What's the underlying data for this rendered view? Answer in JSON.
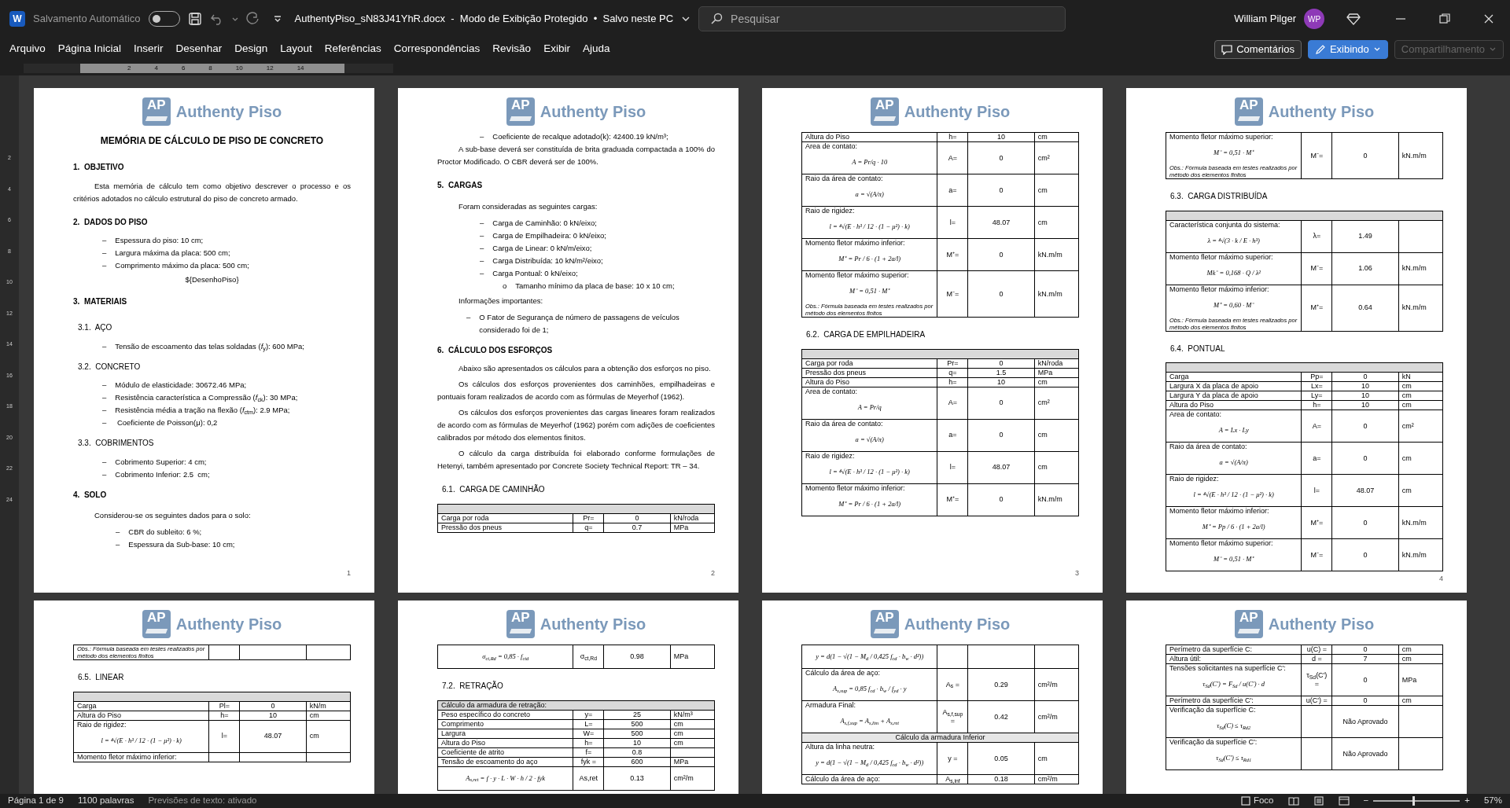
{
  "title_bar": {
    "app_letter": "W",
    "autosave_label": "Salvamento Automático",
    "autosave_on": false,
    "document_title": "AuthentyPiso_sN83J41YhR.docx  -  Modo de Exibição Protegido  •  Salvo neste PC",
    "search_placeholder": "Pesquisar",
    "user_name": "William Pilger",
    "avatar": "WP"
  },
  "ribbon_tabs": [
    {
      "label": "Arquivo",
      "selected": false
    },
    {
      "label": "Página Inicial",
      "selected": false
    },
    {
      "label": "Inserir",
      "selected": false
    },
    {
      "label": "Desenhar",
      "selected": false
    },
    {
      "label": "Design",
      "selected": false
    },
    {
      "label": "Layout",
      "selected": false
    },
    {
      "label": "Referências",
      "selected": false
    },
    {
      "label": "Correspondências",
      "selected": false
    },
    {
      "label": "Revisão",
      "selected": false
    },
    {
      "label": "Exibir",
      "selected": false
    },
    {
      "label": "Ajuda",
      "selected": false
    }
  ],
  "ribbon_buttons": [
    {
      "kind": "comments",
      "label": "Comentários",
      "disabled": false
    },
    {
      "kind": "mode",
      "label": "Exibindo",
      "disabled": false
    },
    {
      "kind": "share",
      "label": "Compartilhamento",
      "disabled": true
    }
  ],
  "ruler": {
    "numbers": [
      "2",
      "4",
      "6",
      "8",
      "10",
      "12",
      "14"
    ],
    "vertical_numbers": [
      "2",
      "4",
      "6",
      "8",
      "10",
      "12",
      "14",
      "16",
      "18",
      "20",
      "22",
      "24"
    ]
  },
  "pages": [
    {
      "logo_mark": "AP",
      "logo_name": "Authenty Piso",
      "blocks": [
        {
          "kind": "title",
          "text": "MEMÓRIA DE CÁLCULO DE PISO DE CONCRETO"
        },
        {
          "kind": "h1",
          "text": "1.  OBJETIVO"
        },
        {
          "kind": "para",
          "text": "Esta memória de cálculo tem como objetivo descrever o processo e os critérios adotados no cálculo estrutural do piso de concreto armado."
        },
        {
          "kind": "h1",
          "text": "2.  DADOS DO PISO"
        },
        {
          "kind": "item",
          "marker": "–",
          "text": "Espessura do piso: 10 cm;"
        },
        {
          "kind": "item",
          "marker": "–",
          "text": "Largura máxima da placa: 500 cm;"
        },
        {
          "kind": "item",
          "marker": "–",
          "text": "Comprimento máximo da placa: 500 cm;"
        },
        {
          "kind": "center",
          "text": "${DesenhoPiso}"
        },
        {
          "kind": "h1",
          "text": "3.  MATERIAIS"
        },
        {
          "kind": "h2",
          "text": "3.1.  AÇO"
        },
        {
          "kind": "item",
          "marker": "–",
          "text": "Tensão de escoamento das telas soldadas (*f*$_{y}$): 600 MPa;"
        },
        {
          "kind": "h2",
          "text": "3.2.  CONCRETO"
        },
        {
          "kind": "item",
          "marker": "–",
          "text": "Módulo de elasticidade: 30672.46 MPa;"
        },
        {
          "kind": "item",
          "marker": "–",
          "text": "Resistência característica a Compressão (*f*$_{ck}$): 30 MPa;"
        },
        {
          "kind": "item",
          "marker": "–",
          "text": "Resistência média a tração na flexão (*f*$_{ctm}$): 2.9 MPa;"
        },
        {
          "kind": "item",
          "marker": "–",
          "text": " Coeficiente de Poisson(μ): 0,2"
        },
        {
          "kind": "h2",
          "text": "3.3.  COBRIMENTOS"
        },
        {
          "kind": "item",
          "marker": "–",
          "text": "Cobrimento Superior: 4 cm;"
        },
        {
          "kind": "item",
          "marker": "–",
          "text": "Cobrimento Inferior: 2.5  cm;"
        },
        {
          "kind": "h1",
          "text": "4.  SOLO"
        },
        {
          "kind": "lead",
          "text": "Considerou-se os seguintes dados para o solo:"
        },
        {
          "kind": "item2",
          "marker": "–",
          "text": "CBR do subleito: 6 %;"
        },
        {
          "kind": "item2",
          "marker": "–",
          "text": "Espessura da Sub-base: 10 cm;"
        },
        {
          "kind": "pagenum",
          "text": "1"
        }
      ]
    },
    {
      "logo_mark": "AP",
      "logo_name": "Authenty Piso",
      "blocks": [
        {
          "kind": "item2",
          "marker": "–",
          "text": "Coeficiente de recalque adotado(k): 42400.19 kN/m³;"
        },
        {
          "kind": "para",
          "text": "A sub-base deverá ser constituída de brita graduada compactada a 100% do Proctor Modificado. O CBR deverá ser de 100%."
        },
        {
          "kind": "h1",
          "text": "5.  CARGAS"
        },
        {
          "kind": "lead",
          "text": "Foram consideradas as seguintes cargas:"
        },
        {
          "kind": "item2",
          "marker": "–",
          "text": "Carga de Caminhão: 0 kN/eixo;"
        },
        {
          "kind": "item2",
          "marker": "–",
          "text": "Carga de Empilhadeira: 0 kN/eixo;"
        },
        {
          "kind": "item2",
          "marker": "–",
          "text": "Carga de Linear: 0 kN/m/eixo;"
        },
        {
          "kind": "item2",
          "marker": "–",
          "text": "Carga Distribuída: 10 kN/m²/eixo;"
        },
        {
          "kind": "item2",
          "marker": "–",
          "text": "Carga Pontual: 0 kN/eixo;"
        },
        {
          "kind": "sub",
          "marker": "o",
          "text": "Tamanho mínimo da placa de base: 10 x 10 cm;"
        },
        {
          "kind": "lead",
          "text": "Informações importantes:"
        },
        {
          "kind": "item",
          "marker": "–",
          "text": "O Fator de Segurança de número de passagens de veículos considerado foi de 1;"
        },
        {
          "kind": "h1",
          "text": "6.  CÁLCULO DOS ESFORÇOS"
        },
        {
          "kind": "para",
          "text": "Abaixo são apresentados os cálculos para a obtenção dos esforços no piso."
        },
        {
          "kind": "para",
          "text": "Os cálculos dos esforços provenientes dos caminhões, empilhadeiras e pontuais foram realizados de acordo com as fórmulas de Meyerhof (1962)."
        },
        {
          "kind": "para",
          "text": "Os cálculos dos esforços provenientes das cargas lineares foram realizados de acordo com as fórmulas de Meyerhof (1962) porém com adições de coeficientes calibrados por método dos elementos finitos."
        },
        {
          "kind": "para",
          "text": "O cálculo da carga distribuída foi elaborado conforme formulações de Hetenyi, também apresentado por Concrete Society Technical Report: TR – 34."
        },
        {
          "kind": "h2",
          "text": "6.1.  CARGA DE CAMINHÃO"
        },
        {
          "kind": "table",
          "rows": [
            {
              "kind": "head"
            },
            {
              "kind": "row",
              "label": "Carga por roda",
              "symbol": "Pr=",
              "value": "0",
              "unit": "kN/roda"
            },
            {
              "kind": "row",
              "label": "Pressão dos pneus",
              "symbol": "q=",
              "value": "0.7",
              "unit": "MPa"
            }
          ]
        },
        {
          "kind": "pagenum",
          "text": "2"
        }
      ]
    },
    {
      "logo_mark": "AP",
      "logo_name": "Authenty Piso",
      "blocks": [
        {
          "kind": "table",
          "rows": [
            {
              "kind": "row",
              "label": "Altura do Piso",
              "symbol": "h=",
              "value": "10",
              "unit": "cm"
            },
            {
              "kind": "row",
              "label": "Area de contato:",
              "formula": "A = Pr/q · 10",
              "symbol": "A=",
              "value": "0",
              "unit": "cm²"
            },
            {
              "kind": "row",
              "label": "Raio da área de contato:",
              "formula": "a = √(A/π)",
              "symbol": "a=",
              "value": "0",
              "unit": "cm"
            },
            {
              "kind": "row",
              "label": "Raio de rigidez:",
              "formula": "l = ⁴√(E · h³ / 12 · (1 − μ²) · k)",
              "symbol": "l=",
              "value": "48.07",
              "unit": "cm"
            },
            {
              "kind": "row",
              "label": "Momento fletor máximo inferior:",
              "formula": "M⁺ = Pr / 6 · (1 + 2a/l)",
              "symbol": "M⁺=",
              "value": "0",
              "unit": "kN.m/m"
            },
            {
              "kind": "row",
              "label": "Momento fletor máximo superior:",
              "formula": "M⁻ = 0,51 · M⁺",
              "obs": "Obs.: Fórmula baseada em testes realizados por método dos elementos finitos",
              "symbol": "M⁻=",
              "value": "0",
              "unit": "kN.m/m"
            }
          ]
        },
        {
          "kind": "h2",
          "text": "6.2.  CARGA DE EMPILHADEIRA"
        },
        {
          "kind": "table",
          "rows": [
            {
              "kind": "head"
            },
            {
              "kind": "row",
              "label": "Carga por roda",
              "symbol": "Pr=",
              "value": "0",
              "unit": "kN/roda"
            },
            {
              "kind": "row",
              "label": "Pressão dos pneus",
              "symbol": "q=",
              "value": "1.5",
              "unit": "MPa"
            },
            {
              "kind": "row",
              "label": "Altura do Piso",
              "symbol": "h=",
              "value": "10",
              "unit": "cm"
            },
            {
              "kind": "row",
              "label": "Area de contato:",
              "formula": "A = Pr/q",
              "symbol": "A=",
              "value": "0",
              "unit": "cm²"
            },
            {
              "kind": "row",
              "label": "Raio da área de contato:",
              "formula": "a = √(A/π)",
              "symbol": "a=",
              "value": "0",
              "unit": "cm"
            },
            {
              "kind": "row",
              "label": "Raio de rigidez:",
              "formula": "l = ⁴√(E · h³ / 12 · (1 − μ²) · k)",
              "symbol": "l=",
              "value": "48.07",
              "unit": "cm"
            },
            {
              "kind": "row",
              "label": "Momento fletor máximo inferior:",
              "formula": "M⁺ = Pr / 6 · (1 + 2a/l)",
              "symbol": "M⁺=",
              "value": "0",
              "unit": "kN.m/m"
            }
          ]
        },
        {
          "kind": "pagenum",
          "text": "3"
        }
      ]
    },
    {
      "logo_mark": "AP",
      "logo_name": "Authenty Piso",
      "blocks": [
        {
          "kind": "table",
          "rows": [
            {
              "kind": "row",
              "label": "Momento fletor máximo superior:",
              "formula": "M⁻ = 0,51 · M⁺",
              "obs": "Obs.: Fórmula baseada em testes realizados por método dos elementos finitos",
              "symbol": "M⁻=",
              "value": "0",
              "unit": "kN.m/m"
            }
          ]
        },
        {
          "kind": "h2",
          "text": "6.3.  CARGA DISTRIBUÍDA"
        },
        {
          "kind": "table",
          "rows": [
            {
              "kind": "head"
            },
            {
              "kind": "row",
              "label": "Característica conjunta do sistema:",
              "formula": "λ = ⁴√(3 · k / E · h³)",
              "symbol": "λ=",
              "value": "1.49"
            },
            {
              "kind": "row",
              "label": "Momento fletor máximo superior:",
              "formula": "Mk⁻ = 0,168 · Q / λ²",
              "symbol": "M⁻=",
              "value": "1.06",
              "unit": "kN.m/m"
            },
            {
              "kind": "row",
              "label": "Momento fletor máximo inferior:",
              "formula": "M⁺ = 0,60 · M⁻",
              "obs": "Obs.: Fórmula baseada em testes realizados por método dos elementos finitos",
              "symbol": "M⁺=",
              "value": "0.64",
              "unit": "kN.m/m"
            }
          ]
        },
        {
          "kind": "h2",
          "text": "6.4.  PONTUAL"
        },
        {
          "kind": "table",
          "rows": [
            {
              "kind": "head"
            },
            {
              "kind": "row",
              "label": "Carga",
              "symbol": "Pp=",
              "value": "0",
              "unit": "kN"
            },
            {
              "kind": "row",
              "label": "Largura X da placa de apoio",
              "symbol": "Lx=",
              "value": "10",
              "unit": "cm"
            },
            {
              "kind": "row",
              "label": "Largura Y da placa de apoio",
              "symbol": "Ly=",
              "value": "10",
              "unit": "cm"
            },
            {
              "kind": "row",
              "label": "Altura do Piso",
              "symbol": "h=",
              "value": "10",
              "unit": "cm"
            },
            {
              "kind": "row",
              "label": "Area de contato:",
              "formula": "A = Lx · Ly",
              "symbol": "A=",
              "value": "0",
              "unit": "cm²"
            },
            {
              "kind": "row",
              "label": "Raio da área de contato:",
              "formula": "a = √(A/π)",
              "symbol": "a=",
              "value": "0",
              "unit": "cm"
            },
            {
              "kind": "row",
              "label": "Raio de rigidez:",
              "formula": "l = ⁴√(E · h³ / 12 · (1 − μ²) · k)",
              "symbol": "l=",
              "value": "48.07",
              "unit": "cm"
            },
            {
              "kind": "row",
              "label": "Momento fletor máximo inferior:",
              "formula": "M⁺ = Pp / 6 · (1 + 2a/l)",
              "symbol": "M⁺=",
              "value": "0",
              "unit": "kN.m/m"
            },
            {
              "kind": "row",
              "label": "Momento fletor máximo superior:",
              "formula": "M⁻ = 0,51 · M⁺",
              "symbol": "M⁻=",
              "value": "0",
              "unit": "kN.m/m"
            }
          ]
        },
        {
          "kind": "pagenum",
          "text": "4"
        }
      ]
    },
    {
      "logo_mark": "AP",
      "logo_name": "Authenty Piso",
      "blocks": [
        {
          "kind": "table",
          "rows": [
            {
              "kind": "row",
              "obs": "Obs.: Fórmula baseada em testes realizados por método dos elementos finitos"
            }
          ]
        },
        {
          "kind": "h2",
          "text": "6.5.  LINEAR"
        },
        {
          "kind": "table",
          "rows": [
            {
              "kind": "head"
            },
            {
              "kind": "row",
              "label": "Carga",
              "symbol": "Pl=",
              "value": "0",
              "unit": "kN/m"
            },
            {
              "kind": "row",
              "label": "Altura do Piso",
              "symbol": "h=",
              "value": "10",
              "unit": "cm"
            },
            {
              "kind": "row",
              "label": "Raio de rigidez:",
              "formula": "l = ⁴√(E · h³ / 12 · (1 − μ²) · k)",
              "symbol": "l=",
              "value": "48.07",
              "unit": "cm"
            },
            {
              "kind": "row",
              "label": "Momento fletor máximo inferior:"
            }
          ]
        }
      ]
    },
    {
      "logo_mark": "AP",
      "logo_name": "Authenty Piso",
      "blocks": [
        {
          "kind": "table",
          "rows": [
            {
              "kind": "row",
              "formula": "σ$_{ct,Rd}$ = 0,85 · f$_{ctd}$",
              "symbol": "σ$_{ct,Rd}$",
              "value": "0.98",
              "unit": "MPa"
            }
          ]
        },
        {
          "kind": "h2",
          "text": "7.2.  RETRAÇÃO"
        },
        {
          "kind": "table",
          "rows": [
            {
              "kind": "headtext",
              "text": "Cálculo da armadura de retração:"
            },
            {
              "kind": "row",
              "label": "Peso específico do concreto",
              "symbol": "y=",
              "value": "25",
              "unit": "kN/m³"
            },
            {
              "kind": "row",
              "label": "Comprimento",
              "symbol": "L=",
              "value": "500",
              "unit": "cm"
            },
            {
              "kind": "row",
              "label": "Largura",
              "symbol": "W=",
              "value": "500",
              "unit": "cm"
            },
            {
              "kind": "row",
              "label": "Altura do Piso",
              "symbol": "h=",
              "value": "10",
              "unit": "cm"
            },
            {
              "kind": "row",
              "label": "Coeficiente de atrito",
              "symbol": "f=",
              "value": "0.8"
            },
            {
              "kind": "row",
              "label": "Tensão de escoamento do aço",
              "symbol": "fyk =",
              "value": "600",
              "unit": "MPa"
            },
            {
              "kind": "row",
              "formula": "A$_{s,ret}$ = f · y · L · W · h / 2 · fyk",
              "symbol": "As,ret",
              "value": "0.13",
              "unit": "cm²/m"
            }
          ]
        }
      ]
    },
    {
      "logo_mark": "AP",
      "logo_name": "Authenty Piso",
      "blocks": [
        {
          "kind": "table",
          "rows": [
            {
              "kind": "row",
              "formula": "y = d(1 − √(1 − M$_{d}$ / 0,425 f$_{cd}$ · b$_{w}$ · d²))"
            },
            {
              "kind": "row",
              "label": "Cálculo da área de aço:",
              "formula": "A$_{s,sup}$ = 0,85 f$_{cd}$ · b$_{w}$ / f$_{yd}$ · y",
              "symbol": "A$_{s}$ =",
              "value": "0.29",
              "unit": "cm²/m"
            },
            {
              "kind": "row",
              "label": "Armadura Final:",
              "formula": "A$_{s,f,sup}$ = A$_{s,lim}$ + A$_{s,ret}$",
              "symbol": "A$_{s,f,sup}$ =",
              "value": "0.42",
              "unit": "cm²/m"
            },
            {
              "kind": "span",
              "text": "Cálculo da armadura Inferior"
            },
            {
              "kind": "row",
              "label": "Altura da linha neutra:",
              "formula": "y = d(1 − √(1 − M$_{d}$ / 0,425 f$_{cd}$ · b$_{w}$ · d²))",
              "symbol": "y =",
              "value": "0.05",
              "unit": "cm"
            },
            {
              "kind": "row",
              "label": "Cálculo da área de aço:",
              "symbol": "A$_{s,inf}$",
              "value": "0.18",
              "unit": "cm²/m"
            }
          ]
        }
      ]
    },
    {
      "logo_mark": "AP",
      "logo_name": "Authenty Piso",
      "blocks": [
        {
          "kind": "table",
          "rows": [
            {
              "kind": "row",
              "label": "Perímetro da superfície C:",
              "symbol": "u(C) =",
              "value": "0",
              "unit": "cm"
            },
            {
              "kind": "row",
              "label": "Altura útil:",
              "symbol": "d =",
              "value": "7",
              "unit": "cm"
            },
            {
              "kind": "row",
              "label": "Tensões solicitantes na superfície C':",
              "formula": "τ$_{Sd}$(C') = F$_{Sd}$ / u(C') · d",
              "symbol": "τ$_{Sd}$(C') =",
              "value": "0",
              "unit": "MPa"
            },
            {
              "kind": "row",
              "label": "Perímetro da superfície C':",
              "symbol": "u(C') =",
              "value": "0",
              "unit": "cm"
            },
            {
              "kind": "row",
              "label": "Verificação da superfície C:",
              "formula": "τ$_{Sd}$(C) ≤ τ$_{Rd2}$",
              "value": "Não Aprovado"
            },
            {
              "kind": "row",
              "label": "Verificação da superfície C':",
              "formula": "τ$_{Sd}$(C') ≤ τ$_{Rd1}$",
              "value": "Não Aprovado"
            }
          ]
        }
      ]
    }
  ],
  "status_bar": {
    "page": "Página 1 de 9",
    "words": "1100 palavras",
    "predictions": "Previsões de texto: ativado",
    "focus": "Foco",
    "zoom_minus": "−",
    "zoom_plus": "+",
    "zoom": {
      "level": 0.45,
      "reading": "57%"
    }
  }
}
